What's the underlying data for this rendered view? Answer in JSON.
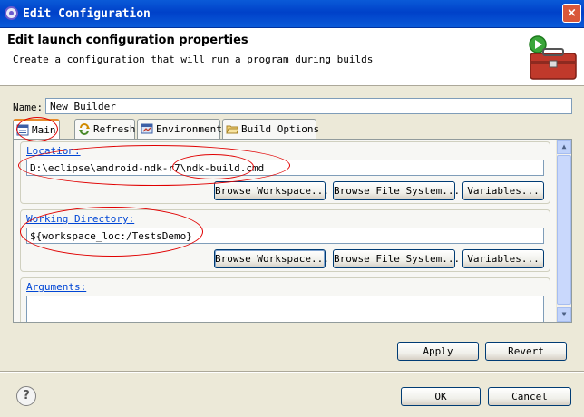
{
  "window": {
    "title": "Edit Configuration",
    "close_label": "×"
  },
  "header": {
    "heading": "Edit launch configuration properties",
    "description": "Create a configuration that will run a program during builds"
  },
  "name": {
    "label": "Name:",
    "value": "New_Builder"
  },
  "tabs": [
    {
      "label": "Main",
      "active": true
    },
    {
      "label": "Refresh"
    },
    {
      "label": "Environment"
    },
    {
      "label": "Build Options"
    }
  ],
  "location": {
    "label": "Location:",
    "value": "D:\\eclipse\\android-ndk-r7\\ndk-build.cmd",
    "browse_workspace": "Browse Workspace...",
    "browse_file_system": "Browse File System...",
    "variables": "Variables..."
  },
  "working_directory": {
    "label": "Working Directory:",
    "value": "${workspace_loc:/TestsDemo}",
    "browse_workspace": "Browse Workspace...",
    "browse_file_system": "Browse File System...",
    "variables": "Variables..."
  },
  "arguments": {
    "label": "Arguments:",
    "value": ""
  },
  "actions": {
    "apply": "Apply",
    "revert": "Revert"
  },
  "footer": {
    "ok": "OK",
    "cancel": "Cancel",
    "help": "?"
  },
  "colors": {
    "titlebar": "#0a5ad8",
    "annotation": "#e00000",
    "link_label": "#0046d5"
  }
}
